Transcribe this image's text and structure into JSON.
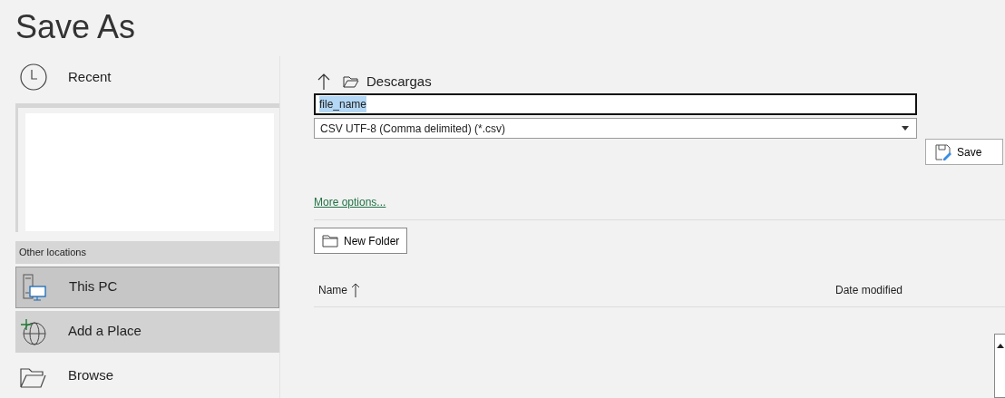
{
  "title": "Save As",
  "recent": {
    "label": "Recent"
  },
  "section_header": "Other locations",
  "locations": [
    {
      "kind": "pc",
      "label": "This PC",
      "selected": true,
      "highlighted": false
    },
    {
      "kind": "place",
      "label": "Add a Place",
      "selected": false,
      "highlighted": true
    },
    {
      "kind": "browse",
      "label": "Browse",
      "selected": false,
      "highlighted": false
    }
  ],
  "breadcrumb": {
    "folder": "Descargas"
  },
  "filename": {
    "value": "file_name",
    "text_selected": true
  },
  "file_type": {
    "value": "CSV UTF-8 (Comma delimited) (*.csv)"
  },
  "save_button": "Save",
  "more_options": "More options...",
  "new_folder_button": "New Folder",
  "columns": [
    {
      "label": "Name",
      "sorted": true
    },
    {
      "label": "Date modified",
      "sorted": false
    }
  ]
}
